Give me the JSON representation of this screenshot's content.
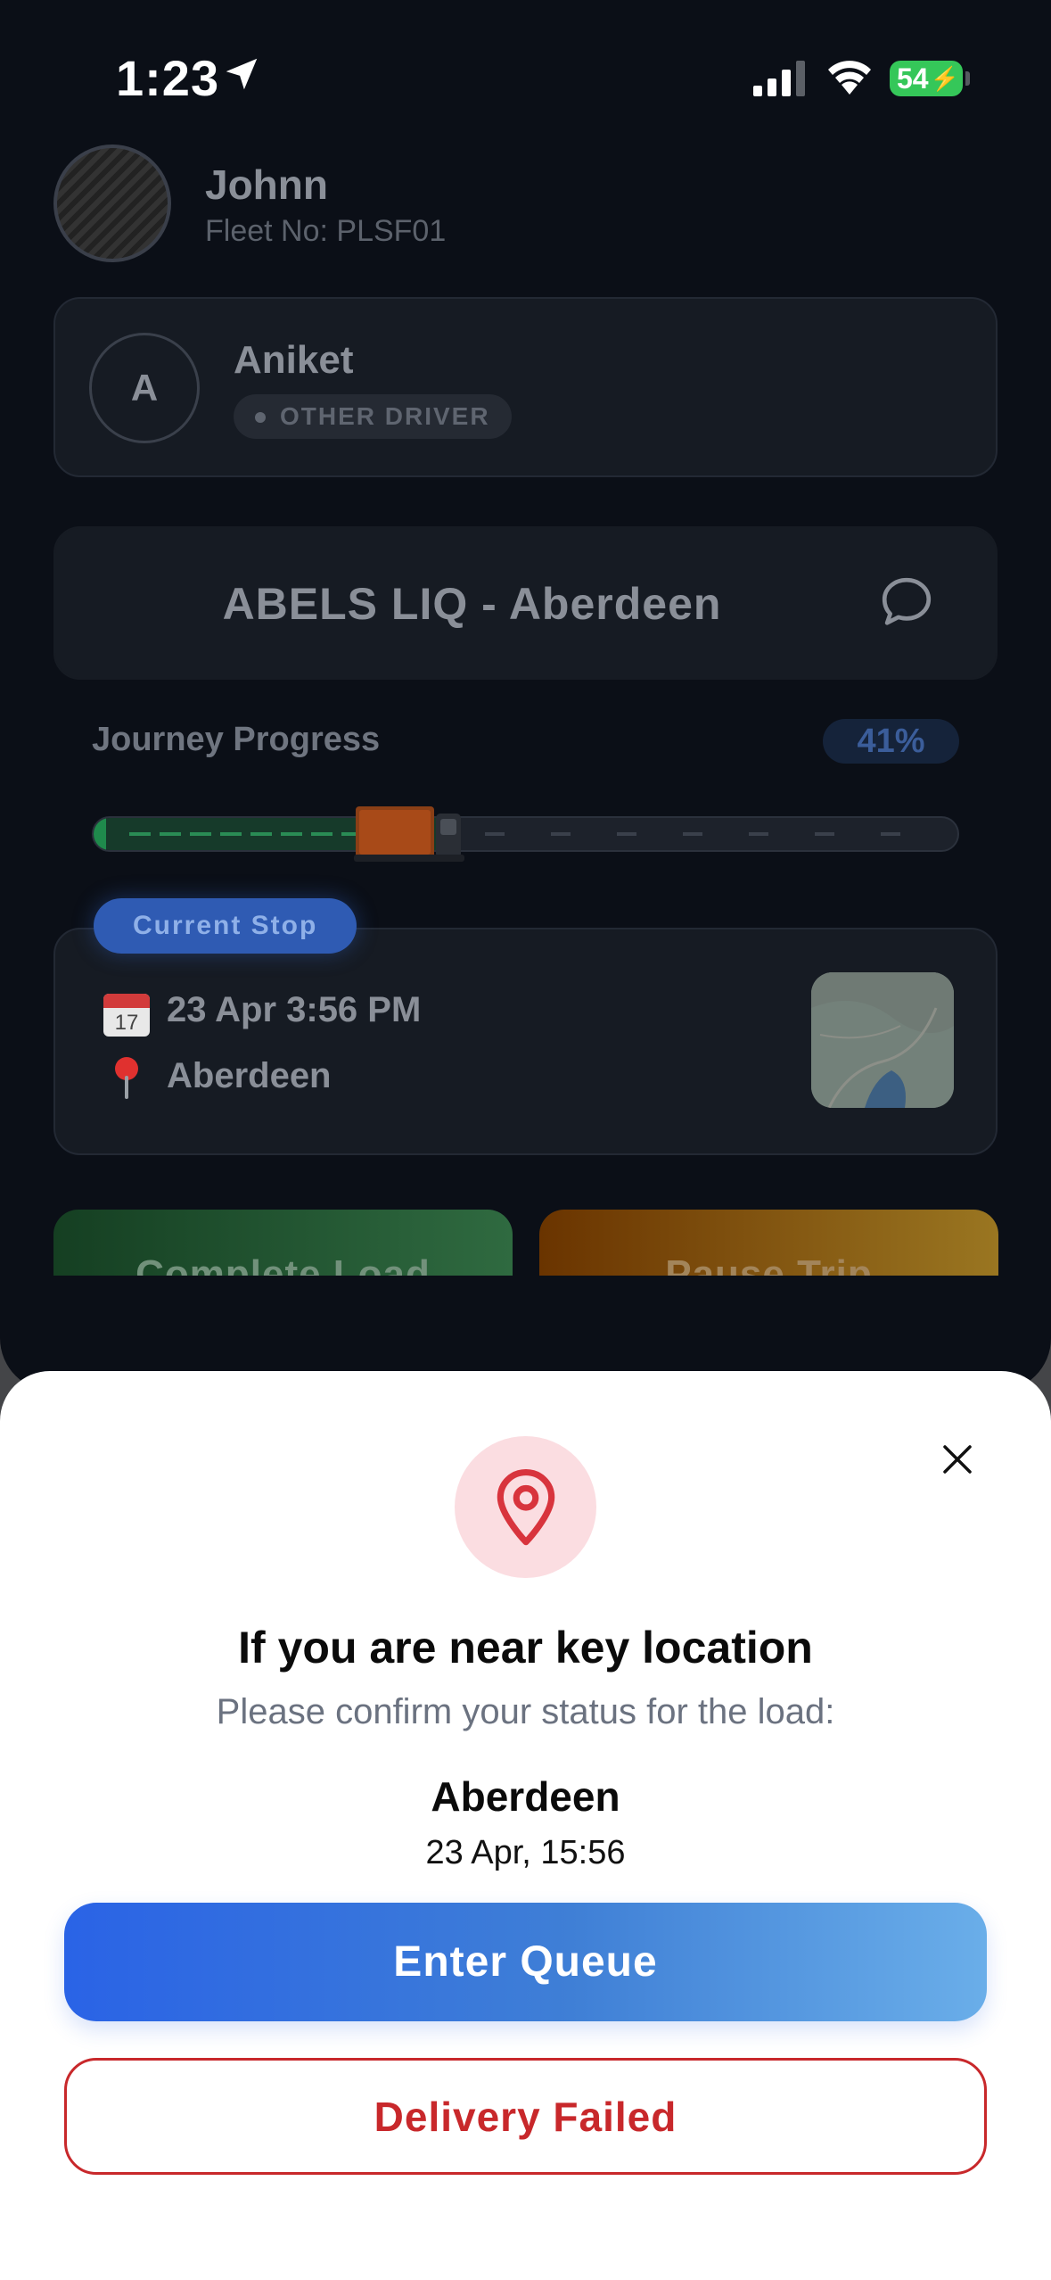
{
  "status_bar": {
    "time": "1:23",
    "battery": "54",
    "icons": [
      "location-arrow-icon",
      "cellular-signal-icon",
      "wifi-icon",
      "battery-charging-icon"
    ]
  },
  "user": {
    "name": "Johnn",
    "fleet": "Fleet No: PLSF01"
  },
  "driver": {
    "initial": "A",
    "name": "Aniket",
    "badge": "OTHER DRIVER"
  },
  "route": {
    "title": "ABELS LIQ - Aberdeen",
    "icon": "chat-bubble-icon"
  },
  "journey": {
    "label": "Journey Progress",
    "percent_label": "41%",
    "progress": 0.41
  },
  "current_stop": {
    "badge": "Current Stop",
    "date": "23 Apr 3:56 PM",
    "location": "Aberdeen",
    "icons": [
      "calendar-icon",
      "map-pin-icon",
      "map-thumbnail"
    ]
  },
  "actions": {
    "complete": "Complete Load",
    "pause": "Pause Trip"
  },
  "sheet": {
    "title": "If you are near key location",
    "subtitle": "Please confirm your status for the load:",
    "place": "Aberdeen",
    "time": "23 Apr, 15:56",
    "primary": "Enter Queue",
    "secondary": "Delivery Failed",
    "colors": {
      "primary": "#2a63e6",
      "danger": "#c8282b",
      "pin_bg": "#fbdde1"
    }
  }
}
